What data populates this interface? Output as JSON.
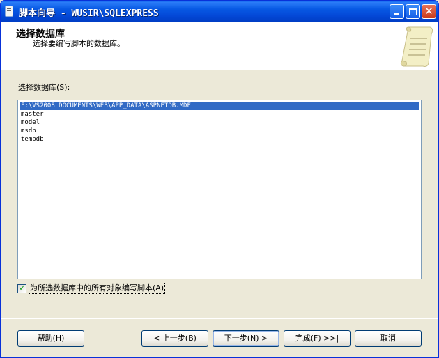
{
  "window": {
    "title": "脚本向导 - WUSIR\\SQLEXPRESS"
  },
  "header": {
    "heading": "选择数据库",
    "subheading": "选择要编写脚本的数据库。"
  },
  "body": {
    "list_label": "选择数据库(S):",
    "databases": [
      "F:\\VS2008 DOCUMENTS\\WEB\\APP_DATA\\ASPNETDB.MDF",
      "master",
      "model",
      "msdb",
      "tempdb"
    ],
    "selected_index": 0,
    "checkbox_label": "为所选数据库中的所有对象编写脚本(A)",
    "checkbox_checked": true
  },
  "footer": {
    "help": "帮助(H)",
    "back": "< 上一步(B)",
    "next": "下一步(N) >",
    "finish": "完成(F) >>|",
    "cancel": "取消"
  },
  "colors": {
    "titlebar": "#0449d8",
    "selection": "#316ac5",
    "window_bg": "#ece9d8"
  },
  "icons": {
    "app": "document-icon",
    "header_graphic": "scroll-icon"
  }
}
